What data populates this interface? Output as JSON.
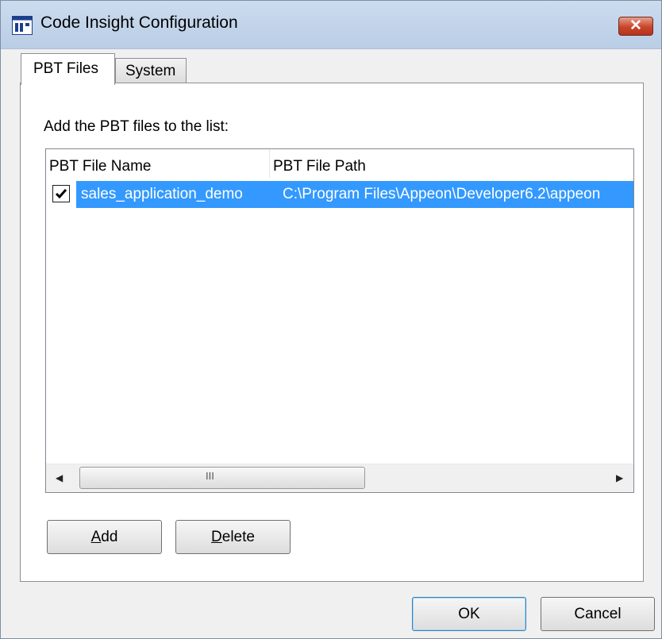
{
  "window": {
    "title": "Code Insight Configuration",
    "close_label": "✕",
    "app_icon": "window-app-icon"
  },
  "tabs": [
    {
      "label": "PBT Files",
      "selected": true
    },
    {
      "label": "System",
      "selected": false
    }
  ],
  "panel": {
    "instruction": "Add the PBT files to the list:",
    "list": {
      "columns": [
        "PBT File Name",
        "PBT File Path"
      ],
      "rows": [
        {
          "checked": true,
          "name": "sales_application_demo",
          "path": "C:\\Program Files\\Appeon\\Developer6.2\\appeon"
        }
      ],
      "scrollbar": {
        "left_arrow": "◀",
        "right_arrow": "▶",
        "grip": "III"
      }
    },
    "buttons": {
      "add": {
        "mnemonic": "A",
        "rest": "dd"
      },
      "delete": {
        "mnemonic": "D",
        "rest": "elete"
      }
    }
  },
  "footer": {
    "ok": "OK",
    "cancel": "Cancel"
  },
  "colors": {
    "selection": "#3399ff",
    "titlebar": "#b9cde5",
    "close_button": "#c8452a"
  }
}
